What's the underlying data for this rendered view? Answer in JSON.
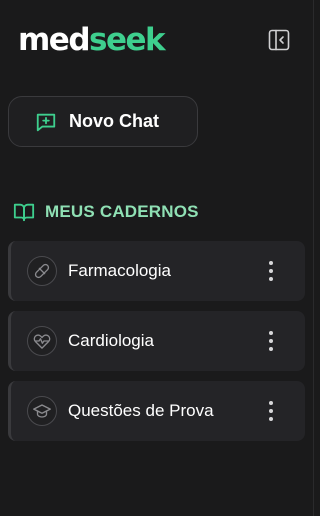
{
  "brand": {
    "part1": "med",
    "part2": "seek",
    "accent": "#3ecf8e"
  },
  "header": {
    "toggle_icon": "sidebar-collapse-icon"
  },
  "new_chat": {
    "label": "Novo Chat",
    "icon": "message-plus-icon"
  },
  "notebooks": {
    "title": "MEUS CADERNOS",
    "title_color": "#8fe0b4",
    "icon": "book-open-icon",
    "items": [
      {
        "label": "Farmacologia",
        "icon": "pill-icon"
      },
      {
        "label": "Cardiologia",
        "icon": "heart-pulse-icon"
      },
      {
        "label": "Questões de Prova",
        "icon": "graduation-cap-icon"
      }
    ]
  }
}
